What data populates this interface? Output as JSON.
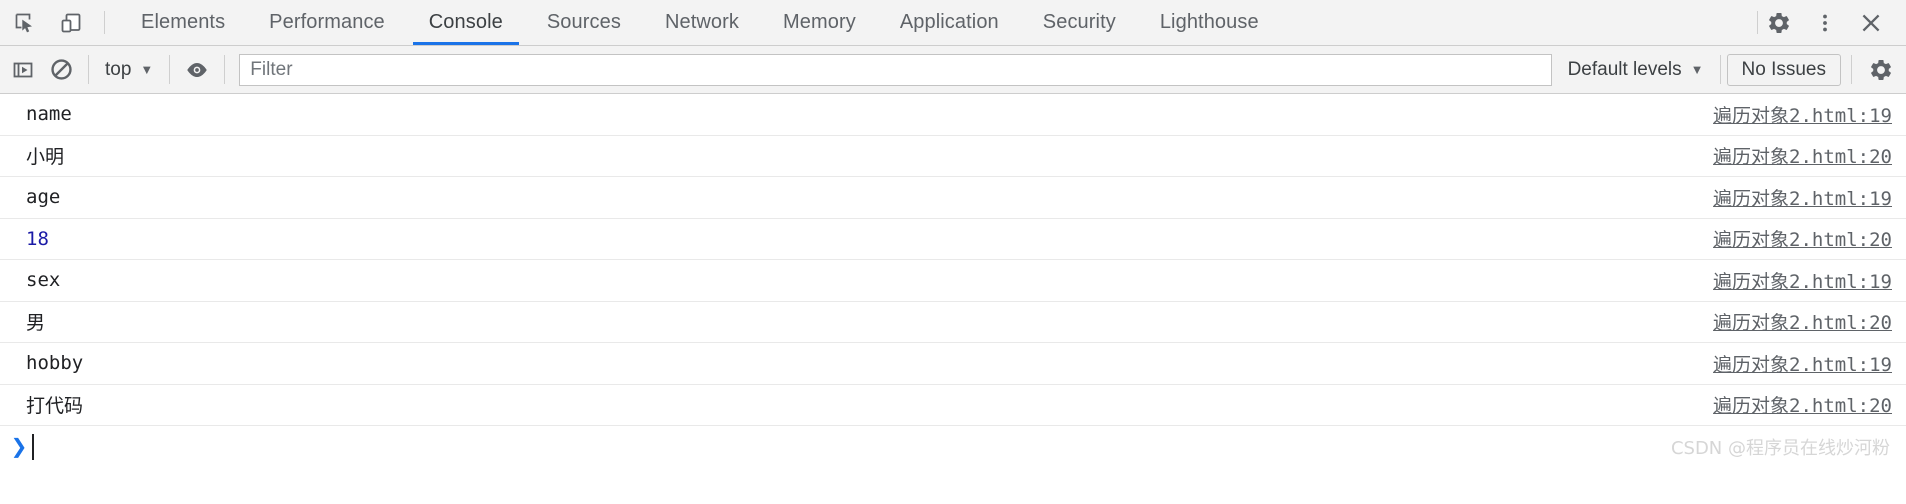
{
  "devtools": {
    "left_icons": [
      {
        "name": "inspect-element-icon",
        "label": "Inspect element"
      },
      {
        "name": "device-toolbar-icon",
        "label": "Toggle device toolbar"
      }
    ],
    "tabs": [
      {
        "label": "Elements",
        "active": false
      },
      {
        "label": "Performance",
        "active": false
      },
      {
        "label": "Console",
        "active": true
      },
      {
        "label": "Sources",
        "active": false
      },
      {
        "label": "Network",
        "active": false
      },
      {
        "label": "Memory",
        "active": false
      },
      {
        "label": "Application",
        "active": false
      },
      {
        "label": "Security",
        "active": false
      },
      {
        "label": "Lighthouse",
        "active": false
      }
    ],
    "right_icons": [
      {
        "name": "settings-gear-icon",
        "label": "Settings"
      },
      {
        "name": "more-options-icon",
        "label": "Customize and control DevTools"
      },
      {
        "name": "close-icon",
        "label": "Close DevTools"
      }
    ],
    "accent_color": "#1a73e8",
    "chrome_bg": "#f3f3f3"
  },
  "toolbar": {
    "sidebar_toggle": "console-sidebar-icon",
    "clear_console": "clear-console-icon",
    "context": {
      "value": "top",
      "caret": "▼"
    },
    "live_expression": "eye-icon",
    "filter": {
      "value": "",
      "placeholder": "Filter"
    },
    "levels": {
      "value": "Default levels",
      "caret": "▼"
    },
    "issues": {
      "label": "No Issues",
      "count": 0
    },
    "settings": "settings-gear-icon"
  },
  "console": {
    "prompt": {
      "chevron": "❯",
      "value": ""
    },
    "logs": [
      {
        "message": "name",
        "kind": "string",
        "source": "遍历对象2.html:19"
      },
      {
        "message": "小明",
        "kind": "cjk",
        "source": "遍历对象2.html:20"
      },
      {
        "message": "age",
        "kind": "string",
        "source": "遍历对象2.html:19"
      },
      {
        "message": "18",
        "kind": "number",
        "source": "遍历对象2.html:20"
      },
      {
        "message": "sex",
        "kind": "string",
        "source": "遍历对象2.html:19"
      },
      {
        "message": "男",
        "kind": "cjk",
        "source": "遍历对象2.html:20"
      },
      {
        "message": "hobby",
        "kind": "string",
        "source": "遍历对象2.html:19"
      },
      {
        "message": "打代码",
        "kind": "cjk",
        "source": "遍历对象2.html:20"
      }
    ]
  },
  "watermark": {
    "text": "CSDN @程序员在线炒河粉"
  }
}
